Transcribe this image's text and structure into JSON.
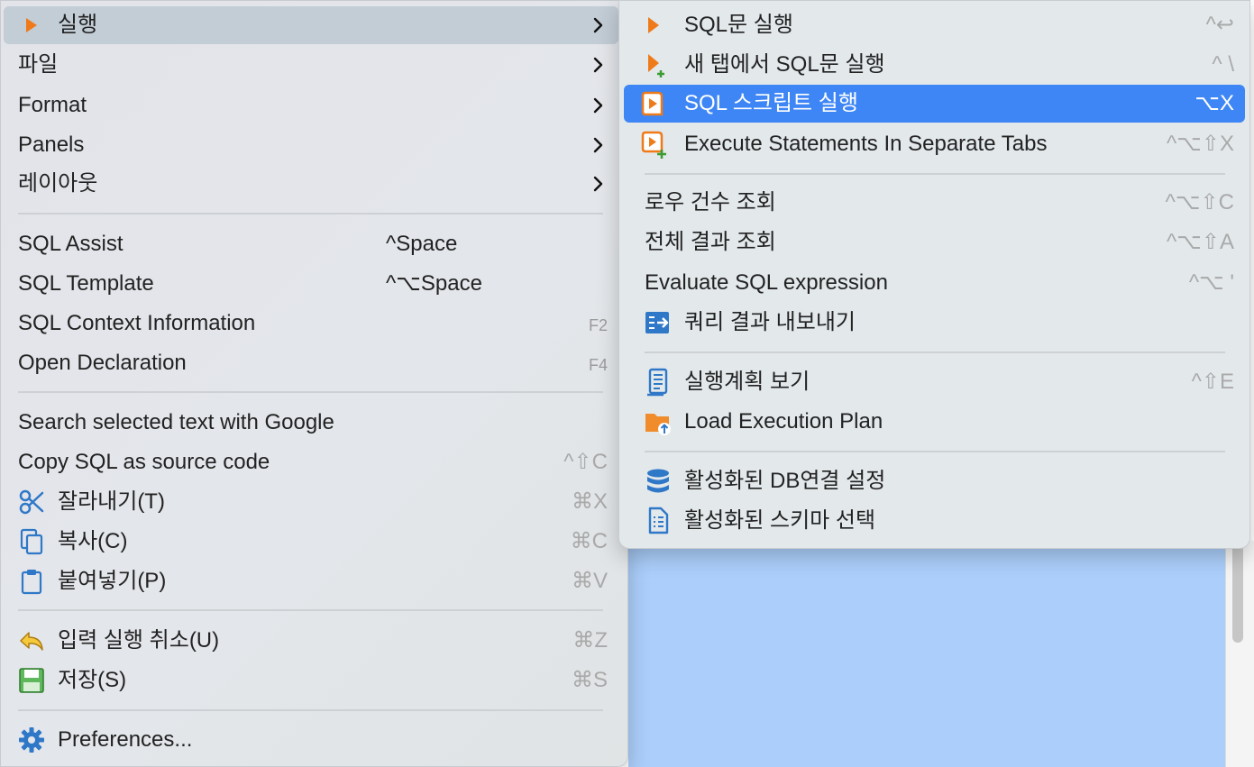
{
  "main_menu": {
    "items": [
      {
        "label": "실행"
      },
      {
        "label": "파일"
      },
      {
        "label": "Format"
      },
      {
        "label": "Panels"
      },
      {
        "label": "레이아웃"
      },
      {
        "label": "SQL Assist",
        "shortcut": "^Space"
      },
      {
        "label": "SQL Template",
        "shortcut": "^⌥Space"
      },
      {
        "label": "SQL Context Information",
        "shortcut": "F2"
      },
      {
        "label": "Open Declaration",
        "shortcut": "F4"
      },
      {
        "label": "Search selected text with Google"
      },
      {
        "label": "Copy SQL as source code",
        "shortcut": "^⇧C"
      },
      {
        "label": "잘라내기(T)",
        "shortcut": "⌘X",
        "icon": "scissors-icon"
      },
      {
        "label": "복사(C)",
        "shortcut": "⌘C",
        "icon": "copy-icon"
      },
      {
        "label": "붙여넣기(P)",
        "shortcut": "⌘V",
        "icon": "clipboard-icon"
      },
      {
        "label": "입력 실행 취소(U)",
        "shortcut": "⌘Z",
        "icon": "undo-icon"
      },
      {
        "label": "저장(S)",
        "shortcut": "⌘S",
        "icon": "save-icon"
      },
      {
        "label": "Preferences...",
        "icon": "gear-icon"
      }
    ]
  },
  "sub_menu": {
    "items": [
      {
        "label": "SQL문 실행",
        "shortcut": "^↩",
        "icon": "run-icon"
      },
      {
        "label": "새 탭에서 SQL문 실행",
        "shortcut": "^ \\",
        "icon": "run-new-tab-icon"
      },
      {
        "label": "SQL 스크립트 실행",
        "shortcut": "⌥X",
        "icon": "run-script-icon"
      },
      {
        "label": "Execute Statements In Separate Tabs",
        "shortcut": "^⌥⇧X",
        "icon": "run-separate-tabs-icon"
      },
      {
        "label": "로우 건수 조회",
        "shortcut": "^⌥⇧C"
      },
      {
        "label": "전체 결과 조회",
        "shortcut": "^⌥⇧A"
      },
      {
        "label": "Evaluate SQL expression",
        "shortcut": "^⌥ '"
      },
      {
        "label": "쿼리 결과 내보내기",
        "icon": "export-icon"
      },
      {
        "label": "실행계획 보기",
        "shortcut": "^⇧E",
        "icon": "execution-plan-icon"
      },
      {
        "label": "Load Execution Plan",
        "icon": "load-plan-folder-icon"
      },
      {
        "label": "활성화된 DB연결 설정",
        "icon": "database-icon"
      },
      {
        "label": "활성화된 스키마 선택",
        "icon": "schema-icon"
      }
    ]
  },
  "colors": {
    "highlight_blue": "#3e86f5",
    "highlight_grey": "#c3cdd6",
    "accent_orange": "#ee7a1a",
    "editor_selection": "#abcefa"
  }
}
